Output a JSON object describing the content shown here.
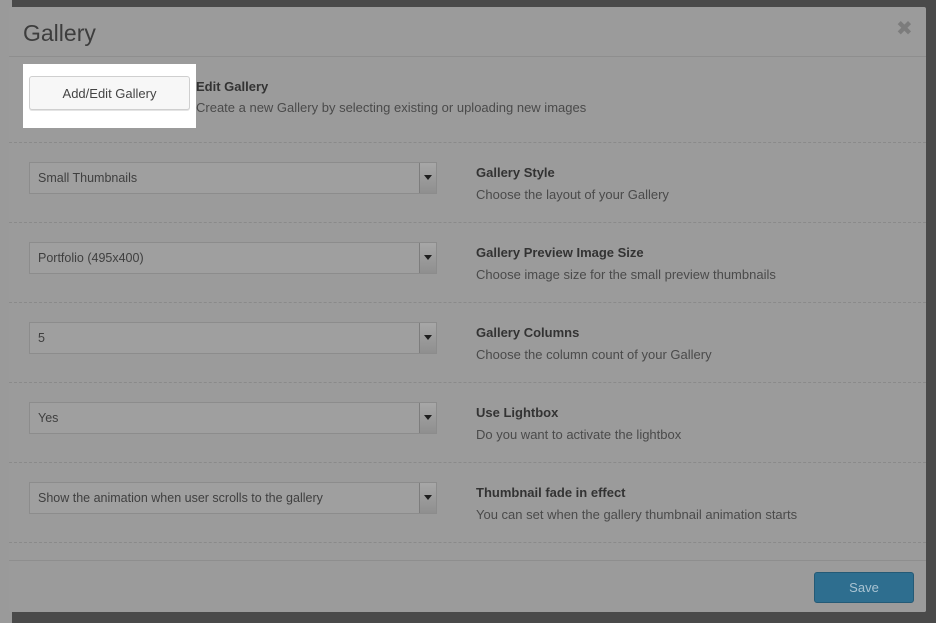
{
  "modal": {
    "title": "Gallery",
    "close_icon": "close-icon"
  },
  "add_edit": {
    "button_label": "Add/Edit Gallery",
    "title": "Edit Gallery",
    "description": "Create a new Gallery by selecting existing or uploading new images"
  },
  "settings": [
    {
      "value": "Small Thumbnails",
      "title": "Gallery Style",
      "description": "Choose the layout of your Gallery"
    },
    {
      "value": "Portfolio (495x400)",
      "title": "Gallery Preview Image Size",
      "description": "Choose image size for the small preview thumbnails"
    },
    {
      "value": "5",
      "title": "Gallery Columns",
      "description": "Choose the column count of your Gallery"
    },
    {
      "value": "Yes",
      "title": "Use Lightbox",
      "description": "Do you want to activate the lightbox"
    },
    {
      "value": "Show the animation when user scrolls to the gallery",
      "title": "Thumbnail fade in effect",
      "description": "You can set when the gallery thumbnail animation starts"
    }
  ],
  "footer": {
    "save_label": "Save"
  },
  "colors": {
    "overlay": "#4a4a4a",
    "modal_bg": "#9b9b9b",
    "primary_button": "#2e6e8f",
    "highlight": "#ffffff"
  }
}
